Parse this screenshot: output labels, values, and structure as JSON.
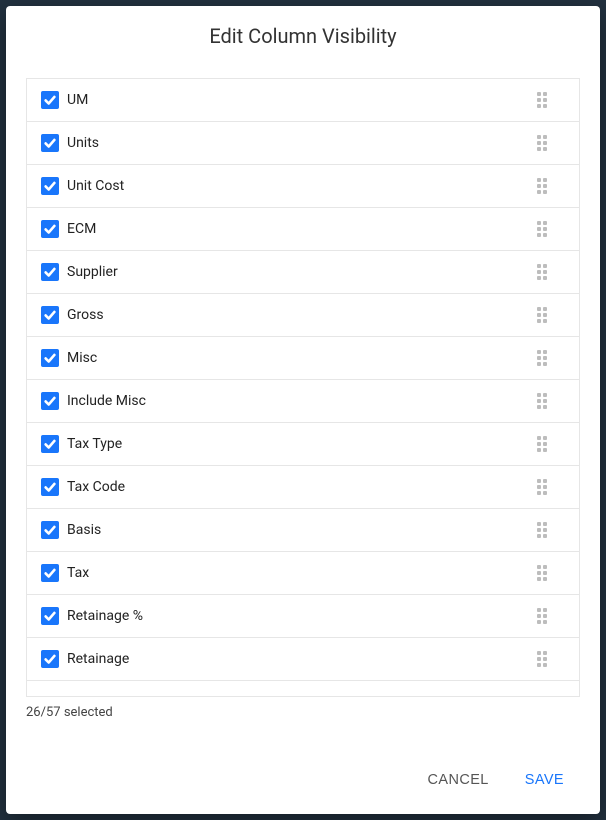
{
  "dialog": {
    "title": "Edit Column Visibility",
    "status": "26/57 selected",
    "cancel_label": "CANCEL",
    "save_label": "SAVE"
  },
  "items": [
    {
      "label": "UM",
      "checked": true
    },
    {
      "label": "Units",
      "checked": true
    },
    {
      "label": "Unit Cost",
      "checked": true
    },
    {
      "label": "ECM",
      "checked": true
    },
    {
      "label": "Supplier",
      "checked": true
    },
    {
      "label": "Gross",
      "checked": true
    },
    {
      "label": "Misc",
      "checked": true
    },
    {
      "label": "Include Misc",
      "checked": true
    },
    {
      "label": "Tax Type",
      "checked": true
    },
    {
      "label": "Tax Code",
      "checked": true
    },
    {
      "label": "Basis",
      "checked": true
    },
    {
      "label": "Tax",
      "checked": true
    },
    {
      "label": "Retainage %",
      "checked": true
    },
    {
      "label": "Retainage",
      "checked": true
    }
  ]
}
